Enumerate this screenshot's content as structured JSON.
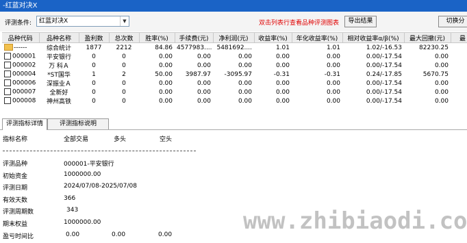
{
  "window": {
    "title": "-红蓝对决X"
  },
  "toolbar": {
    "label": "评测条件:",
    "select_value": "红蓝对决X",
    "hint": "双击列表行查看品种评测图表",
    "export_label": "导出结果",
    "switch_label": "切换分"
  },
  "grid": {
    "columns": [
      "品种代码",
      "品种名称",
      "盈利数",
      "总次数",
      "胜率(%)",
      "手续费(元)",
      "净利润(元)",
      "收益率(%)",
      "年化收益率(%)",
      "相对收益率α/β(%)",
      "最大回撤(元)",
      "最"
    ],
    "rows": [
      {
        "code": "------",
        "name": "综合统计",
        "win": "1877",
        "total": "2212",
        "rate": "84.86",
        "fee": "4577983....",
        "profit": "5481692....",
        "ret": "1.01",
        "annual": "1.01",
        "rel": "1.02/-16.53",
        "dd": "82230.25",
        "x": ""
      },
      {
        "code": "000001",
        "name": "平安银行",
        "win": "0",
        "total": "0",
        "rate": "0.00",
        "fee": "0.00",
        "profit": "0.00",
        "ret": "0.00",
        "annual": "0.00",
        "rel": "0.00/-17.54",
        "dd": "0.00",
        "x": ""
      },
      {
        "code": "000002",
        "name": "万 科Ａ",
        "win": "0",
        "total": "0",
        "rate": "0.00",
        "fee": "0.00",
        "profit": "0.00",
        "ret": "0.00",
        "annual": "0.00",
        "rel": "0.00/-17.54",
        "dd": "0.00",
        "x": ""
      },
      {
        "code": "000004",
        "name": "*ST国华",
        "win": "1",
        "total": "2",
        "rate": "50.00",
        "fee": "3987.97",
        "profit": "-3095.97",
        "ret": "-0.31",
        "annual": "-0.31",
        "rel": "0.24/-17.85",
        "dd": "5670.75",
        "x": ""
      },
      {
        "code": "000006",
        "name": "深振业Ａ",
        "win": "0",
        "total": "0",
        "rate": "0.00",
        "fee": "0.00",
        "profit": "0.00",
        "ret": "0.00",
        "annual": "0.00",
        "rel": "0.00/-17.54",
        "dd": "0.00",
        "x": ""
      },
      {
        "code": "000007",
        "name": "全新好",
        "win": "0",
        "total": "0",
        "rate": "0.00",
        "fee": "0.00",
        "profit": "0.00",
        "ret": "0.00",
        "annual": "0.00",
        "rel": "0.00/-17.54",
        "dd": "0.00",
        "x": ""
      },
      {
        "code": "000008",
        "name": "神州高铁",
        "win": "0",
        "total": "0",
        "rate": "0.00",
        "fee": "0.00",
        "profit": "0.00",
        "ret": "0.00",
        "annual": "0.00",
        "rel": "0.00/-17.54",
        "dd": "0.00",
        "x": ""
      }
    ]
  },
  "tabs": [
    "评测指标详情",
    "评测指标说明"
  ],
  "detail": {
    "headers": [
      "指标名称",
      "全部交易",
      "多头",
      "空头"
    ],
    "lines": [
      {
        "label": "评测品种",
        "value": "000001-平安银行",
        "long": "",
        "short": ""
      },
      {
        "label": "初始资金",
        "value": "1000000.00",
        "long": "",
        "short": ""
      },
      {
        "label": "评测日期",
        "value": "2024/07/08-2025/07/08",
        "long": "",
        "short": ""
      },
      {
        "label": "有效天数",
        "value": "366",
        "long": "",
        "short": ""
      },
      {
        "label": "评测周期数",
        "value": "343",
        "long": "",
        "short": ""
      },
      {
        "label": "期末权益",
        "value": "1000000.00",
        "long": "",
        "short": ""
      },
      {
        "label": "盈亏时间比",
        "value": "0.00",
        "long": "0.00",
        "short": "0.00"
      }
    ]
  },
  "watermark": "www.zhibiaodi.com"
}
